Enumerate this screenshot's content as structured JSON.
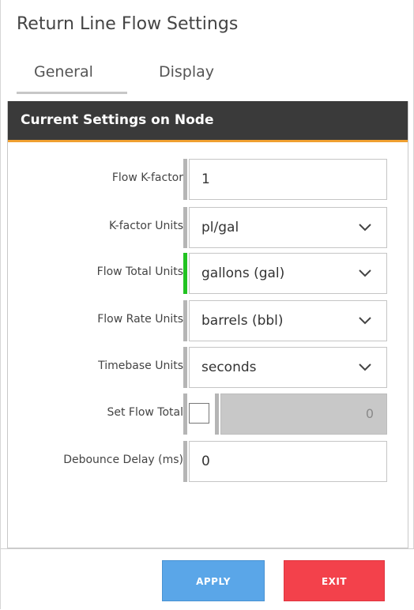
{
  "window": {
    "title": "Return Line Flow Settings"
  },
  "tabs": [
    {
      "label": "General",
      "active": true
    },
    {
      "label": "Display",
      "active": false
    }
  ],
  "panel": {
    "header": "Current Settings on Node"
  },
  "fields": {
    "flow_k_factor": {
      "label": "Flow K-factor",
      "value": "1"
    },
    "k_factor_units": {
      "label": "K-factor Units",
      "value": "pl/gal",
      "icon": "chevron-down-icon"
    },
    "flow_total_units": {
      "label": "Flow Total Units",
      "value": "gallons (gal)",
      "icon": "chevron-down-icon",
      "changed": true
    },
    "flow_rate_units": {
      "label": "Flow Rate Units",
      "value": "barrels (bbl)",
      "icon": "chevron-down-icon"
    },
    "timebase_units": {
      "label": "Timebase Units",
      "value": "seconds",
      "icon": "chevron-down-icon"
    },
    "set_flow_total": {
      "label": "Set Flow Total",
      "checked": false,
      "value": "0"
    },
    "debounce_delay": {
      "label": "Debounce Delay (ms)",
      "value": "0"
    }
  },
  "buttons": {
    "apply": "APPLY",
    "exit": "EXIT"
  },
  "colors": {
    "header_bg": "#3a3a3a",
    "header_accent": "#f0a030",
    "changed_indicator": "#22c322",
    "apply_bg": "#5aa6e8",
    "exit_bg": "#f3414b"
  }
}
